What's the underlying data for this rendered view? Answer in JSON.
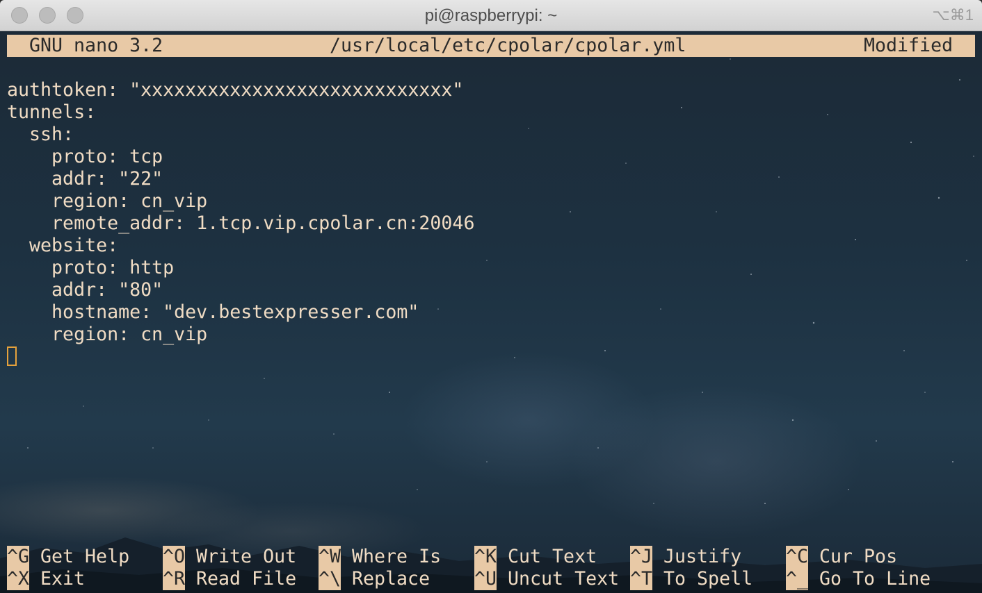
{
  "window": {
    "title": "pi@raspberrypi: ~",
    "shortcut_hint": "⌥⌘1"
  },
  "nano": {
    "version_label": "GNU nano 3.2",
    "file_path": "/usr/local/etc/cpolar/cpolar.yml",
    "modified_label": "Modified"
  },
  "editor_lines": [
    "authtoken: \"xxxxxxxxxxxxxxxxxxxxxxxxxxxx\"",
    "tunnels:",
    "  ssh:",
    "    proto: tcp",
    "    addr: \"22\"",
    "    region: cn_vip",
    "    remote_addr: 1.tcp.vip.cpolar.cn:20046",
    "  website:",
    "    proto: http",
    "    addr: \"80\"",
    "    hostname: \"dev.bestexpresser.com\"",
    "    region: cn_vip"
  ],
  "shortcuts": [
    {
      "key": "^G",
      "label": "Get Help"
    },
    {
      "key": "^O",
      "label": "Write Out"
    },
    {
      "key": "^W",
      "label": "Where Is"
    },
    {
      "key": "^K",
      "label": "Cut Text"
    },
    {
      "key": "^J",
      "label": "Justify"
    },
    {
      "key": "^C",
      "label": "Cur Pos"
    },
    {
      "key": "^X",
      "label": "Exit"
    },
    {
      "key": "^R",
      "label": "Read File"
    },
    {
      "key": "^\\",
      "label": "Replace"
    },
    {
      "key": "^U",
      "label": "Uncut Text"
    },
    {
      "key": "^T",
      "label": "To Spell"
    },
    {
      "key": "^_",
      "label": "Go To Line"
    }
  ],
  "colors": {
    "status_bar_bg": "#e8c9a6",
    "text": "#f0dcc4",
    "cursor": "#e6a23c"
  }
}
